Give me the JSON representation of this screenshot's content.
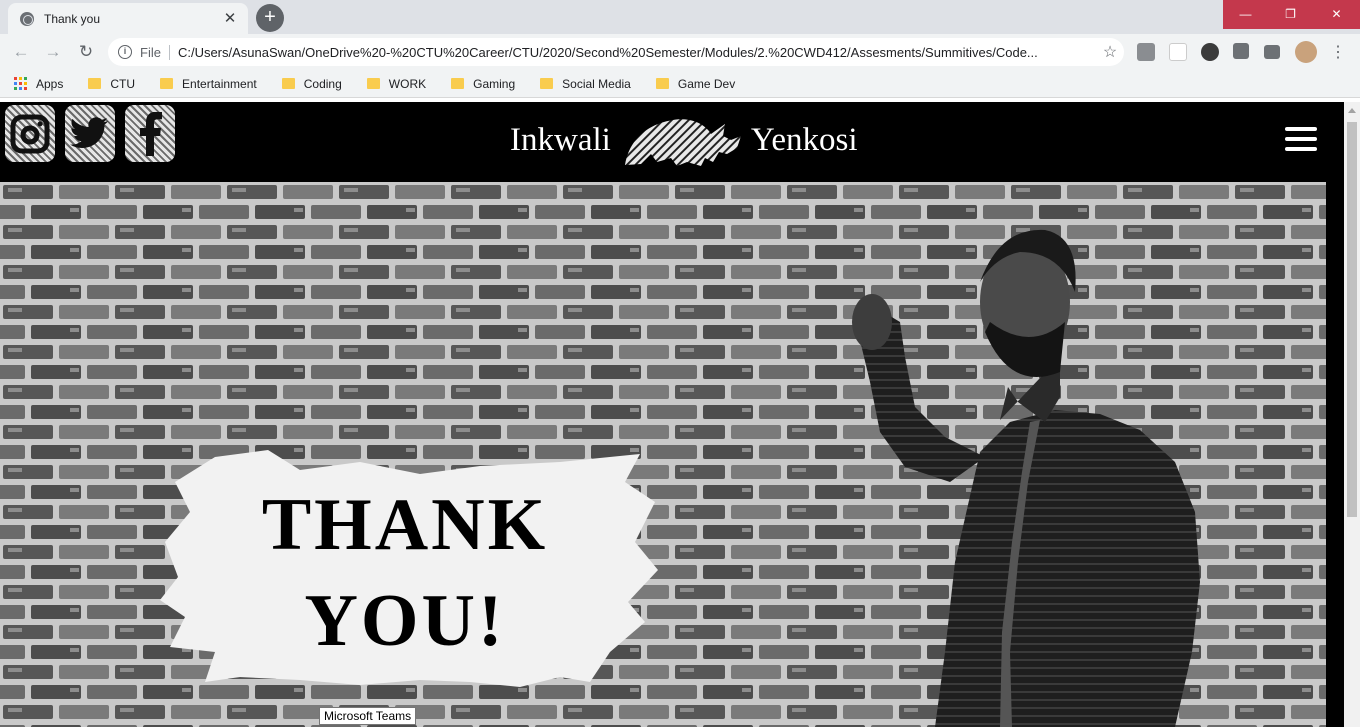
{
  "browser": {
    "tab": {
      "title": "Thank you",
      "close_glyph": "✕"
    },
    "new_tab_glyph": "+",
    "window_controls": {
      "minimize": "—",
      "restore": "❐",
      "close": "✕"
    },
    "nav": {
      "back_glyph": "←",
      "forward_glyph": "→",
      "reload_glyph": "↻"
    },
    "address": {
      "scheme_label": "File",
      "url": "C:/Users/AsunaSwan/OneDrive%20-%20CTU%20Career/CTU/2020/Second%20Semester/Modules/2.%20CWD412/Assesments/Summitives/Code...",
      "star_glyph": "☆"
    },
    "menu_glyph": "⋮",
    "bookmarks": [
      "Apps",
      "CTU",
      "Entertainment",
      "Coding",
      "WORK",
      "Gaming",
      "Social Media",
      "Game Dev"
    ]
  },
  "site": {
    "brand_left": "Inkwali",
    "brand_right": "Yenkosi",
    "hero": {
      "line1": "THANK",
      "line2": "YOU!"
    },
    "tooltip": "Microsoft Teams"
  },
  "colors": {
    "header_bg": "#000000",
    "window_close": "#c4384c",
    "folder": "#f9cc4e"
  }
}
